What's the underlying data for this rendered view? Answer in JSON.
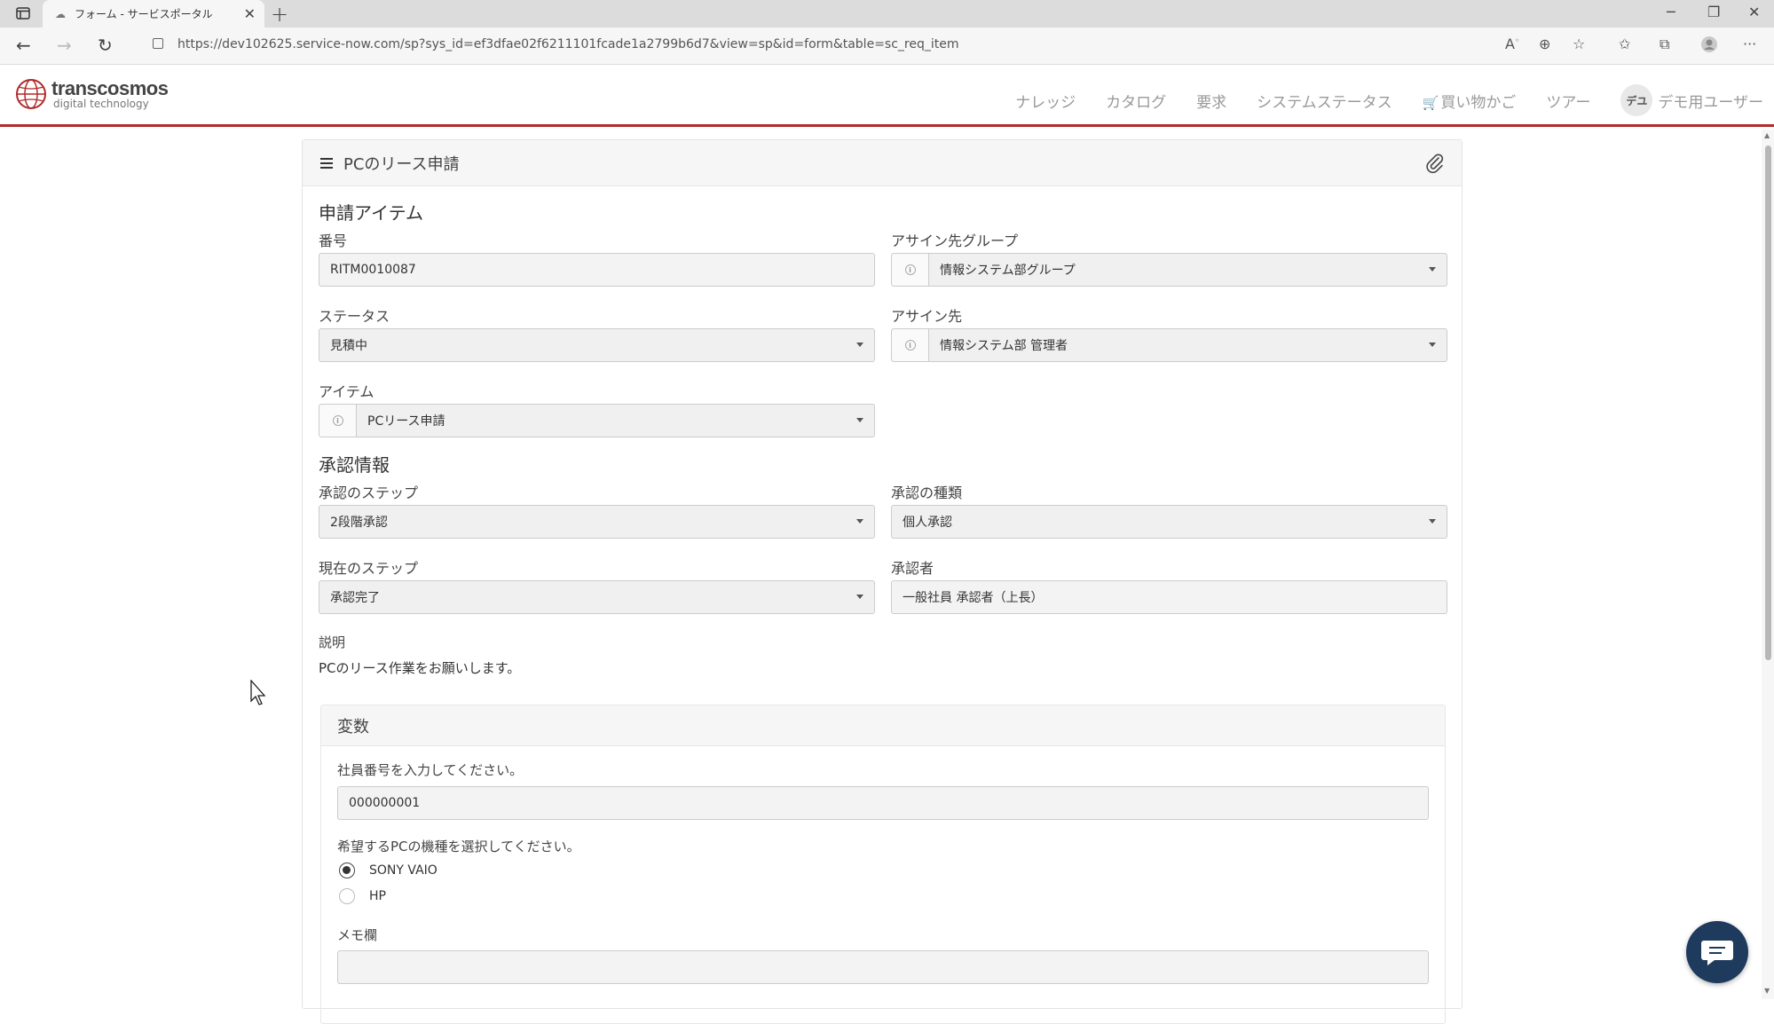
{
  "browser": {
    "tab_title": "フォーム - サービスポータル",
    "url": "https://dev102625.service-now.com/sp?sys_id=ef3dfae02f6211101fcade1a2799b6d7&view=sp&id=form&table=sc_req_item"
  },
  "header": {
    "logo_main": "transcosmos",
    "logo_sub": "digital technology",
    "brand_color": "#b22a2a",
    "nav": [
      "ナレッジ",
      "カタログ",
      "要求",
      "システムステータス",
      "買い物かご",
      "ツアー"
    ],
    "user_initials": "デユ",
    "user_name": "デモ用ユーザー"
  },
  "form": {
    "title": "PCのリース申請",
    "section_request": "申請アイテム",
    "number_label": "番号",
    "number_value": "RITM0010087",
    "assign_group_label": "アサイン先グループ",
    "assign_group_value": "情報システム部グループ",
    "status_label": "ステータス",
    "status_value": "見積中",
    "assignee_label": "アサイン先",
    "assignee_value": "情報システム部 管理者",
    "item_label": "アイテム",
    "item_value": "PCリース申請",
    "section_approval": "承認情報",
    "approval_step_label": "承認のステップ",
    "approval_step_value": "2段階承認",
    "approval_type_label": "承認の種類",
    "approval_type_value": "個人承認",
    "current_step_label": "現在のステップ",
    "current_step_value": "承認完了",
    "approver_label": "承認者",
    "approver_value": "一般社員 承認者（上長）",
    "description_label": "説明",
    "description_value": "PCのリース作業をお願いします。"
  },
  "variables": {
    "title": "変数",
    "employee_label": "社員番号を入力してください。",
    "employee_value": "000000001",
    "pc_label": "希望するPCの機種を選択してください。",
    "pc_options": [
      "SONY VAIO",
      "HP"
    ],
    "pc_selected": "SONY VAIO",
    "memo_label": "メモ欄",
    "memo_value": ""
  }
}
